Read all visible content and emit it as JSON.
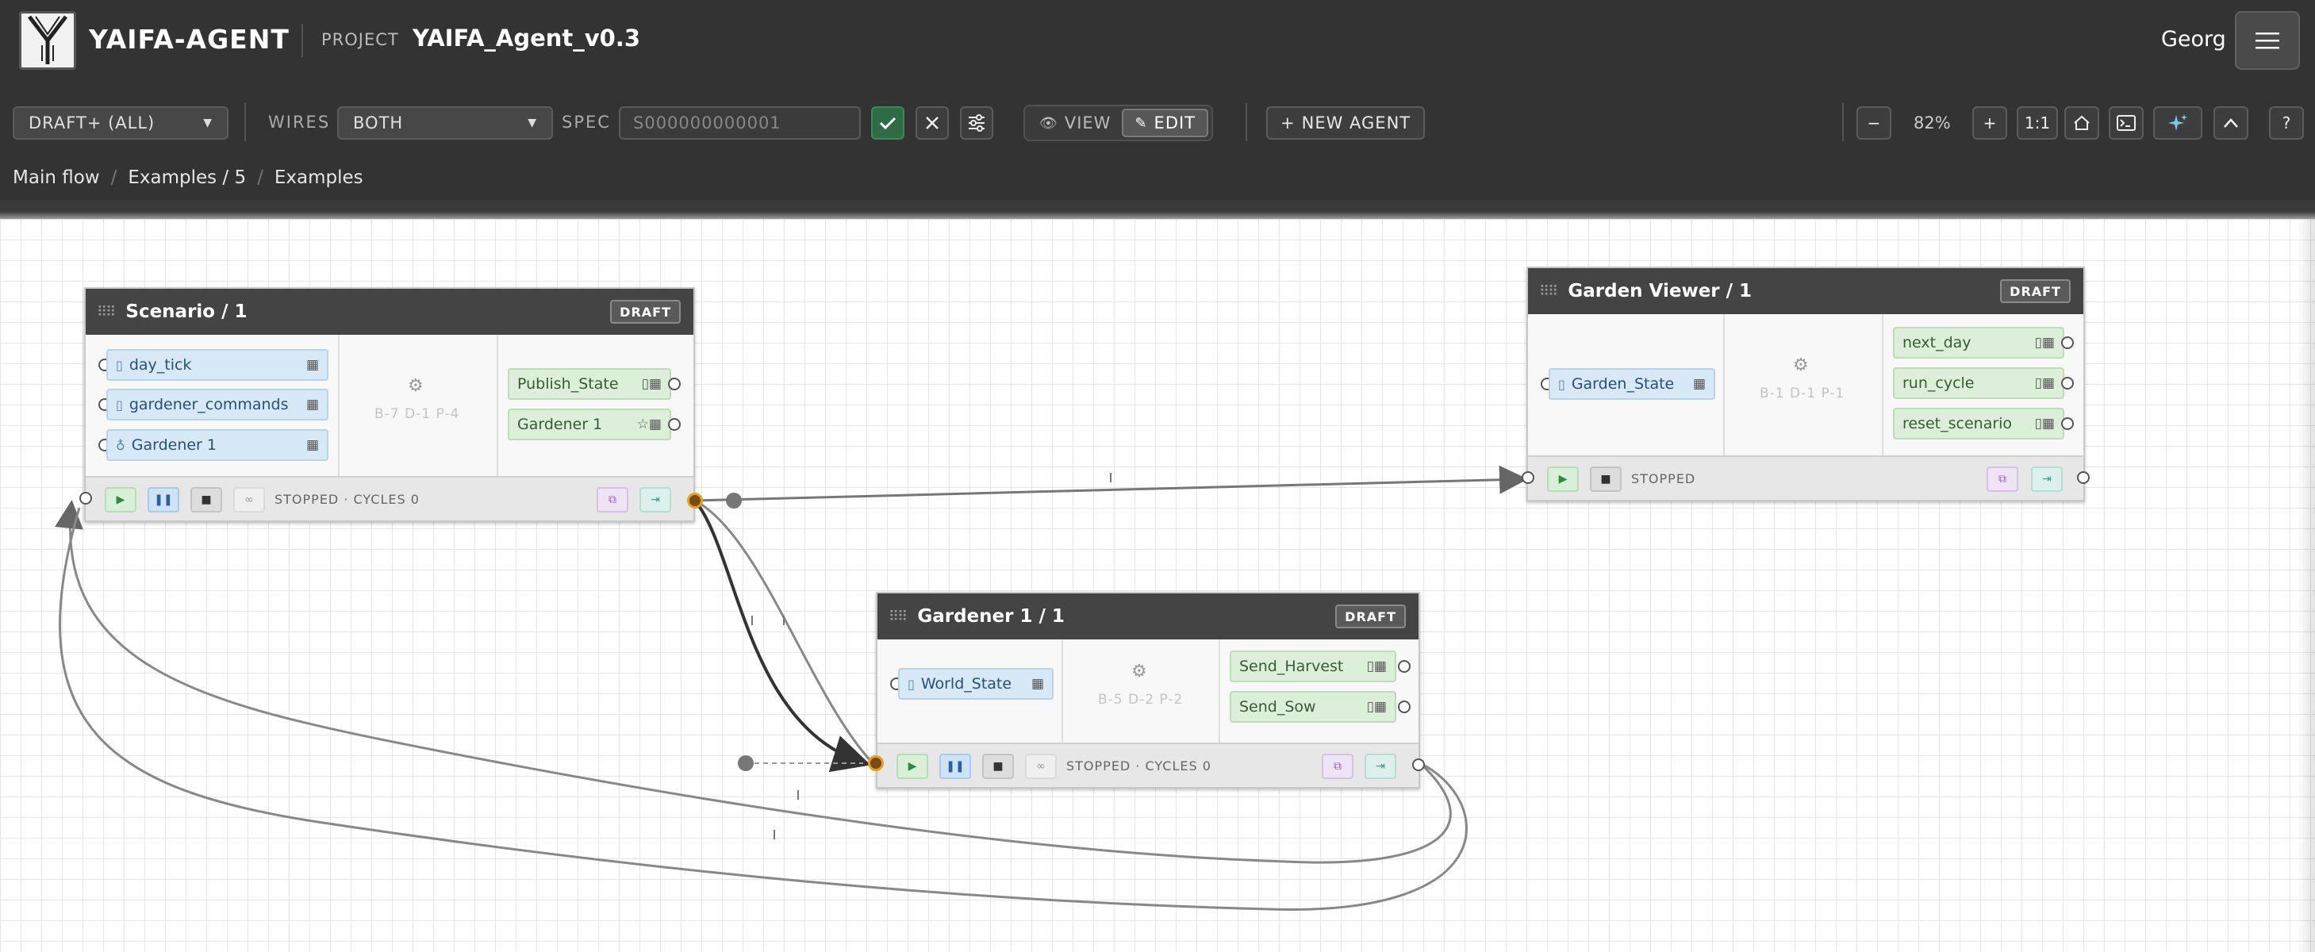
{
  "header": {
    "app_title": "YAIFA-AGENT",
    "project_label": "PROJECT",
    "project_name": "YAIFA_Agent_v0.3",
    "user_name": "Georg",
    "menu_icon": "hamburger-icon"
  },
  "toolbar": {
    "filter_value": "DRAFT+ (ALL)",
    "wires_label": "WIRES",
    "wires_value": "BOTH",
    "spec_label": "SPEC",
    "spec_value": "S000000000001",
    "view_label": "VIEW",
    "edit_label": "EDIT",
    "new_agent_label": "NEW AGENT",
    "zoom_out": "−",
    "zoom_value": "82%",
    "zoom_in": "+",
    "zoom_reset": "1:1",
    "help": "?"
  },
  "breadcrumb": [
    "Main flow",
    "Examples / 5",
    "Examples"
  ],
  "nodes": {
    "scenario": {
      "title": "Scenario / 1",
      "badge": "DRAFT",
      "inputs": [
        "day_tick",
        "gardener_commands",
        "Gardener 1"
      ],
      "stats": "B-7  D-1  P-4",
      "outputs": [
        "Publish_State",
        "Gardener 1"
      ],
      "status": "STOPPED · CYCLES 0"
    },
    "garden_viewer": {
      "title": "Garden Viewer / 1",
      "badge": "DRAFT",
      "inputs": [
        "Garden_State"
      ],
      "stats": "B-1  D-1  P-1",
      "outputs": [
        "next_day",
        "run_cycle",
        "reset_scenario"
      ],
      "status": "STOPPED"
    },
    "gardener": {
      "title": "Gardener 1 / 1",
      "badge": "DRAFT",
      "inputs": [
        "World_State"
      ],
      "stats": "B-5  D-2  P-2",
      "outputs": [
        "Send_Harvest",
        "Send_Sow"
      ],
      "status": "STOPPED · CYCLES 0"
    }
  },
  "colors": {
    "header_bg": "#333333",
    "canvas_bg": "#ffffff",
    "grid": "#e6e6e6",
    "input_pin": "#d7e8f6",
    "output_pin": "#dcefd9",
    "hub": "#e6a020"
  }
}
